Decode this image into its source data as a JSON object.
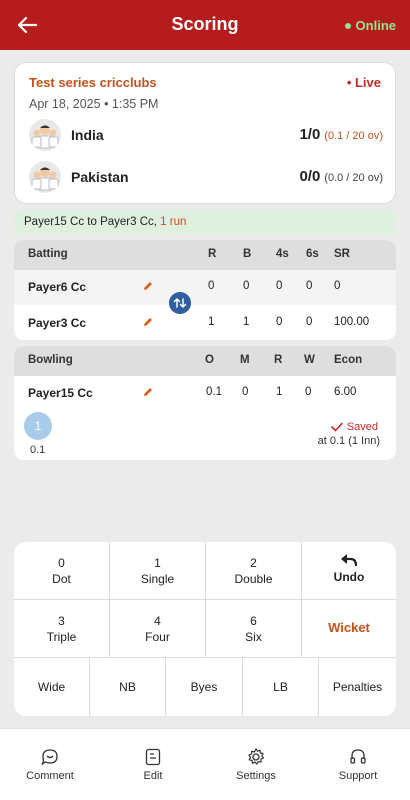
{
  "header": {
    "title": "Scoring",
    "status": "Online"
  },
  "match": {
    "series": "Test series cricclubs",
    "live": "Live",
    "date": "Apr 18, 2025",
    "time": "1:35 PM",
    "teams": [
      {
        "name": "India",
        "score": "1/0",
        "overs": "(0.1 / 20 ov)"
      },
      {
        "name": "Pakistan",
        "score": "0/0",
        "overs": "(0.0 / 20 ov)"
      }
    ]
  },
  "commentary": {
    "text": "Payer15 Cc to  Payer3 Cc, ",
    "runs": "1 run"
  },
  "batting": {
    "headers": [
      "Batting",
      "R",
      "B",
      "4s",
      "6s",
      "SR"
    ],
    "rows": [
      {
        "name": "Payer6 Cc",
        "r": "0",
        "b": "0",
        "fours": "0",
        "sixes": "0",
        "sr": "0"
      },
      {
        "name": "Payer3 Cc",
        "r": "1",
        "b": "1",
        "fours": "0",
        "sixes": "0",
        "sr": "100.00"
      }
    ]
  },
  "bowling": {
    "headers": [
      "Bowling",
      "O",
      "M",
      "R",
      "W",
      "Econ"
    ],
    "rows": [
      {
        "name": "Payer15 Cc",
        "o": "0.1",
        "m": "0",
        "r": "1",
        "w": "0",
        "econ": "6.00"
      }
    ],
    "last_ball": "1",
    "last_ball_over": "0.1",
    "saved": "Saved",
    "saved_at": "at 0.1 (1 Inn)"
  },
  "keypad": {
    "dot": {
      "value": "0",
      "label": "Dot"
    },
    "single": {
      "value": "1",
      "label": "Single"
    },
    "double": {
      "value": "2",
      "label": "Double"
    },
    "undo": "Undo",
    "triple": {
      "value": "3",
      "label": "Triple"
    },
    "four": {
      "value": "4",
      "label": "Four"
    },
    "six": {
      "value": "6",
      "label": "Six"
    },
    "wicket": "Wicket",
    "wide": "Wide",
    "nb": "NB",
    "byes": "Byes",
    "lb": "LB",
    "penalties": "Penalties"
  },
  "nav": {
    "comment": "Comment",
    "edit": "Edit",
    "settings": "Settings",
    "support": "Support"
  },
  "colors": {
    "header_red": "#b71c1c",
    "accent_orange": "#c5511a",
    "online_green": "#8fe58a",
    "swap_blue": "#2f5f9e"
  }
}
